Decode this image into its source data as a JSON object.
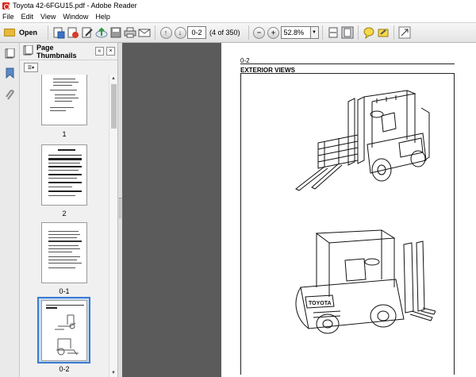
{
  "window": {
    "title": "Toyota 42-6FGU15.pdf - Adobe Reader"
  },
  "menu": {
    "items": [
      "File",
      "Edit",
      "View",
      "Window",
      "Help"
    ]
  },
  "toolbar": {
    "open_label": "Open",
    "page_field_value": "0-2",
    "page_count": "(4 of 350)",
    "zoom_value": "52.8%",
    "icons": [
      "create-pdf-icon",
      "collaborate-icon",
      "sign-icon",
      "upload-icon",
      "save-icon",
      "print-icon",
      "email-icon",
      "previous-page-icon",
      "next-page-icon",
      "zoom-out-icon",
      "zoom-in-icon",
      "fit-width-icon",
      "fit-page-icon",
      "comment-icon",
      "highlight-icon",
      "expand-icon"
    ]
  },
  "thumbnails_pane": {
    "title": "Page Thumbnails",
    "pages": [
      {
        "label": "1"
      },
      {
        "label": "2"
      },
      {
        "label": "0-1"
      },
      {
        "label": "0-2",
        "selected": true
      }
    ]
  },
  "document": {
    "page_number": "0-2",
    "heading": "EXTERIOR VIEWS"
  },
  "colors": {
    "doc_background": "#5b5b5b",
    "selection_border": "#3a7ad0",
    "selection_fill": "#c8dcf4",
    "toolbar": "#e4e4e4"
  }
}
